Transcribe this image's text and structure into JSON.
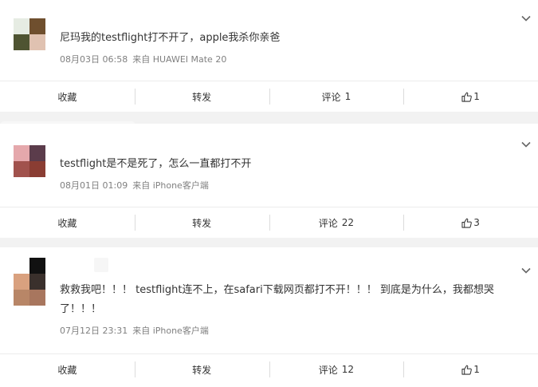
{
  "posts": [
    {
      "text": "尼玛我的testflight打不开了，apple我杀你亲爸",
      "date": "08月03日 06:58",
      "source": "来自 HUAWEI Mate 20",
      "actions": {
        "favorite": "收藏",
        "repost": "转发",
        "comment": "评论",
        "comment_count": "1",
        "like_count": "1"
      },
      "avatar_colors": [
        "#e6ece3",
        "#6f4f2e",
        "#4f5432",
        "#e0c2b1"
      ]
    },
    {
      "text": "testflight是不是死了，怎么一直都打不开",
      "date": "08月01日 01:09",
      "source": "来自 iPhone客户端",
      "actions": {
        "favorite": "收藏",
        "repost": "转发",
        "comment": "评论",
        "comment_count": "22",
        "like_count": "3"
      },
      "avatar_colors": [
        "#e5a8ac",
        "#5b3c4b",
        "#a1524d",
        "#8a3d33"
      ]
    },
    {
      "text": "救救我吧！！！ testflight连不上，在safari下载网页都打不开！！！ 到底是为什么，我都想哭了！！！",
      "date": "07月12日 23:31",
      "source": "来自 iPhone客户端",
      "actions": {
        "favorite": "收藏",
        "repost": "转发",
        "comment": "评论",
        "comment_count": "12",
        "like_count": "1"
      },
      "avatar_colors": [
        "#d9a17f",
        "#3a302c",
        "#b88667",
        "#a8765e"
      ]
    }
  ],
  "icons": {
    "expand": "chevron-down-icon",
    "like": "thumbs-up-icon"
  }
}
